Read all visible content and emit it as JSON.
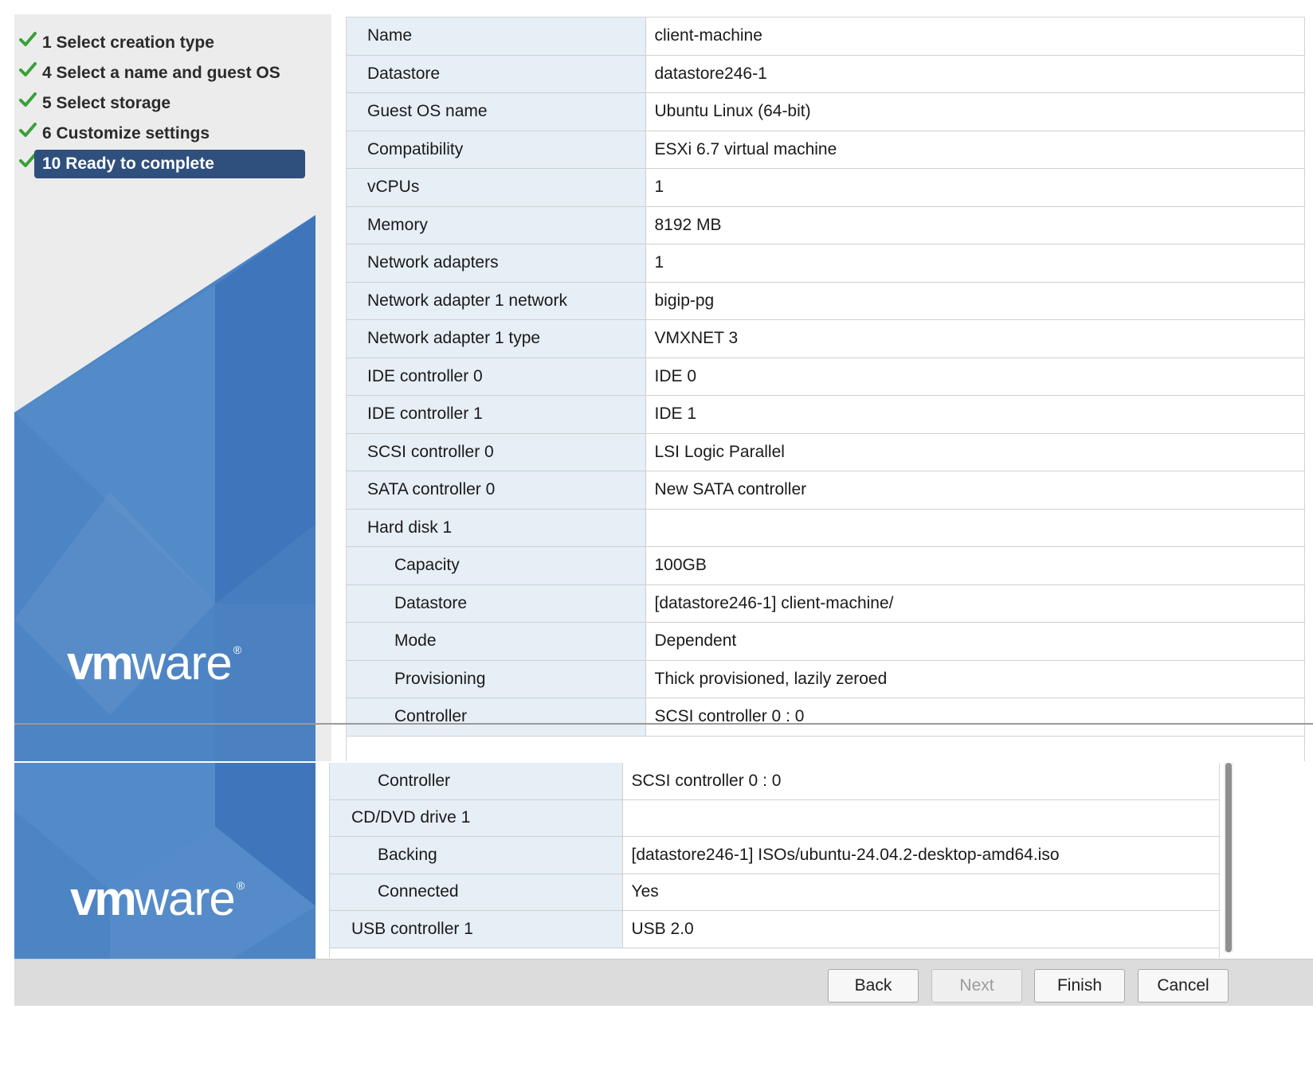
{
  "wizard": {
    "steps": [
      {
        "label": "1 Select creation type",
        "completed": true,
        "active": false
      },
      {
        "label": "4 Select a name and guest OS",
        "completed": true,
        "active": false
      },
      {
        "label": "5 Select storage",
        "completed": true,
        "active": false
      },
      {
        "label": "6 Customize settings",
        "completed": true,
        "active": false
      },
      {
        "label": "10 Ready to complete",
        "completed": true,
        "active": true
      }
    ],
    "logo": {
      "bold": "vm",
      "light": "ware",
      "mark": "®"
    }
  },
  "summary_top": [
    {
      "key": "Name",
      "value": "client-machine"
    },
    {
      "key": "Datastore",
      "value": "datastore246-1"
    },
    {
      "key": "Guest OS name",
      "value": "Ubuntu Linux (64-bit)"
    },
    {
      "key": "Compatibility",
      "value": "ESXi 6.7 virtual machine"
    },
    {
      "key": "vCPUs",
      "value": "1"
    },
    {
      "key": "Memory",
      "value": "8192 MB"
    },
    {
      "key": "Network adapters",
      "value": "1"
    },
    {
      "key": "Network adapter 1 network",
      "value": "bigip-pg"
    },
    {
      "key": "Network adapter 1 type",
      "value": "VMXNET 3"
    },
    {
      "key": "IDE controller 0",
      "value": "IDE 0"
    },
    {
      "key": "IDE controller 1",
      "value": "IDE 1"
    },
    {
      "key": "SCSI controller 0",
      "value": "LSI Logic Parallel"
    },
    {
      "key": "SATA controller 0",
      "value": "New SATA controller"
    },
    {
      "key": "Hard disk 1",
      "value": ""
    },
    {
      "key": "Capacity",
      "value": "100GB",
      "sub": true
    },
    {
      "key": "Datastore",
      "value": "[datastore246-1] client-machine/",
      "sub": true
    },
    {
      "key": "Mode",
      "value": "Dependent",
      "sub": true
    },
    {
      "key": "Provisioning",
      "value": "Thick provisioned, lazily zeroed",
      "sub": true
    },
    {
      "key": "Controller",
      "value": "SCSI controller 0 : 0",
      "sub": true
    }
  ],
  "summary_bottom": [
    {
      "key": "Controller",
      "value": "SCSI controller 0 : 0",
      "sub": true
    },
    {
      "key": "CD/DVD drive 1",
      "value": ""
    },
    {
      "key": "Backing",
      "value": "[datastore246-1] ISOs/ubuntu-24.04.2-desktop-amd64.iso",
      "sub": true
    },
    {
      "key": "Connected",
      "value": "Yes",
      "sub": true
    },
    {
      "key": "USB controller 1",
      "value": "USB 2.0"
    }
  ],
  "footer": {
    "back_label": "Back",
    "next_label": "Next",
    "finish_label": "Finish",
    "cancel_label": "Cancel"
  },
  "colors": {
    "active_step_bg": "#2f4f7d",
    "check_green": "#3aa03a",
    "key_cell_bg": "#e6eef6",
    "brand_blue": "#4d84c4"
  }
}
